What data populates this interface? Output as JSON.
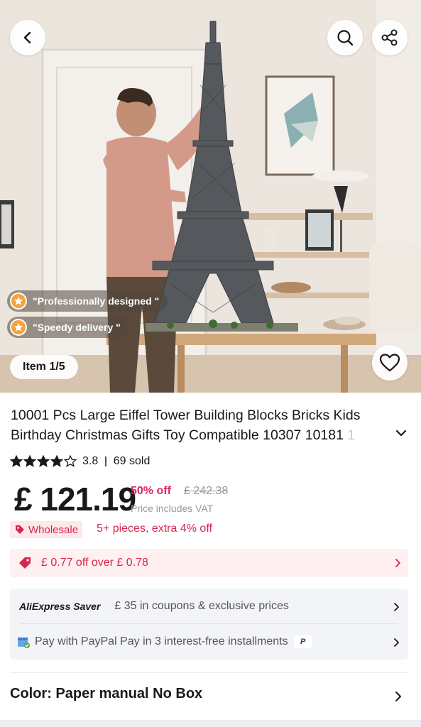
{
  "hero": {
    "features": [
      "\"Professionally designed \"",
      "\"Speedy delivery \""
    ],
    "item_counter": "Item 1/5"
  },
  "product": {
    "title_line1": "10001 Pcs Large Eiffel Tower Building Blocks Bricks Kids",
    "title_line2": "Birthday Christmas Gifts Toy Compatible 10307 10181",
    "title_fade": " 1",
    "rating": "3.8",
    "rating_value": 3.8,
    "sold": "69 sold"
  },
  "pricing": {
    "currency": "£",
    "price": " 121.19",
    "discount": "50% off",
    "original_price": "£ 242.38",
    "vat_note": "Price includes VAT",
    "wholesale_label": "Wholesale",
    "wholesale_text": "5+ pieces, extra 4% off",
    "coupon_text": "£ 0.77 off over  £ 0.78"
  },
  "saver": {
    "logo": "AliExpress Saver",
    "coupons_text": "£ 35 in coupons & exclusive prices",
    "paypal_text": "Pay with PayPal Pay in 3 interest-free installments",
    "paypal_badge": "P"
  },
  "variant": {
    "color_label": "Color: Paper manual No Box"
  },
  "colors": {
    "accent_red": "#d7264d",
    "discount_pink": "#e0245e",
    "star_orange": "#f6a33b"
  },
  "icons": [
    "back-arrow-icon",
    "search-icon",
    "share-icon",
    "heart-icon",
    "star-icon",
    "coupon-tag-icon",
    "chevron-right-icon",
    "chevron-down-icon",
    "paypal-icon"
  ]
}
